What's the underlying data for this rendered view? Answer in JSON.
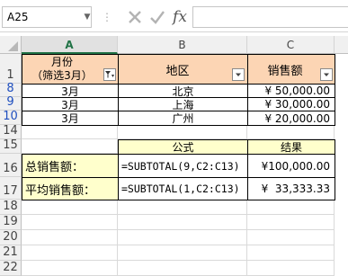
{
  "formula_bar": {
    "name_box": "A25",
    "cancel_icon": "cancel-x-icon",
    "enter_icon": "checkmark-icon",
    "function_icon": "fx-icon",
    "function_label": "fx",
    "formula": ""
  },
  "columns": [
    "A",
    "B",
    "C"
  ],
  "rows": {
    "r1": "1",
    "r8": "8",
    "r9": "9",
    "r10": "10",
    "r14": "14",
    "r15": "15",
    "r16": "16",
    "r17": "17",
    "r18": "18",
    "r19": "19",
    "r20": "20",
    "r21": "21",
    "r22": "22"
  },
  "header": {
    "a1_line1": "月份",
    "a1_line2": "（筛选3月）",
    "b1": "地区",
    "c1": "销售额"
  },
  "data_rows": [
    {
      "month": "3月",
      "region": "北京",
      "amount": "¥ 50,000.00"
    },
    {
      "month": "3月",
      "region": "上海",
      "amount": "¥ 30,000.00"
    },
    {
      "month": "3月",
      "region": "广州",
      "amount": "¥ 20,000.00"
    }
  ],
  "summary": {
    "formula_header": "公式",
    "result_header": "结果",
    "total_label": "总销售额：",
    "total_formula": "=SUBTOTAL(9,C2:C13)",
    "total_result": "¥100,000.00",
    "avg_label": "平均销售额：",
    "avg_formula": "=SUBTOTAL(1,C2:C13)",
    "avg_result": "¥  33,333.33"
  },
  "colors": {
    "header_fill": "#fcd5b4",
    "summary_fill": "#ffffcc",
    "filtered_row_number": "#1f4fbf"
  }
}
